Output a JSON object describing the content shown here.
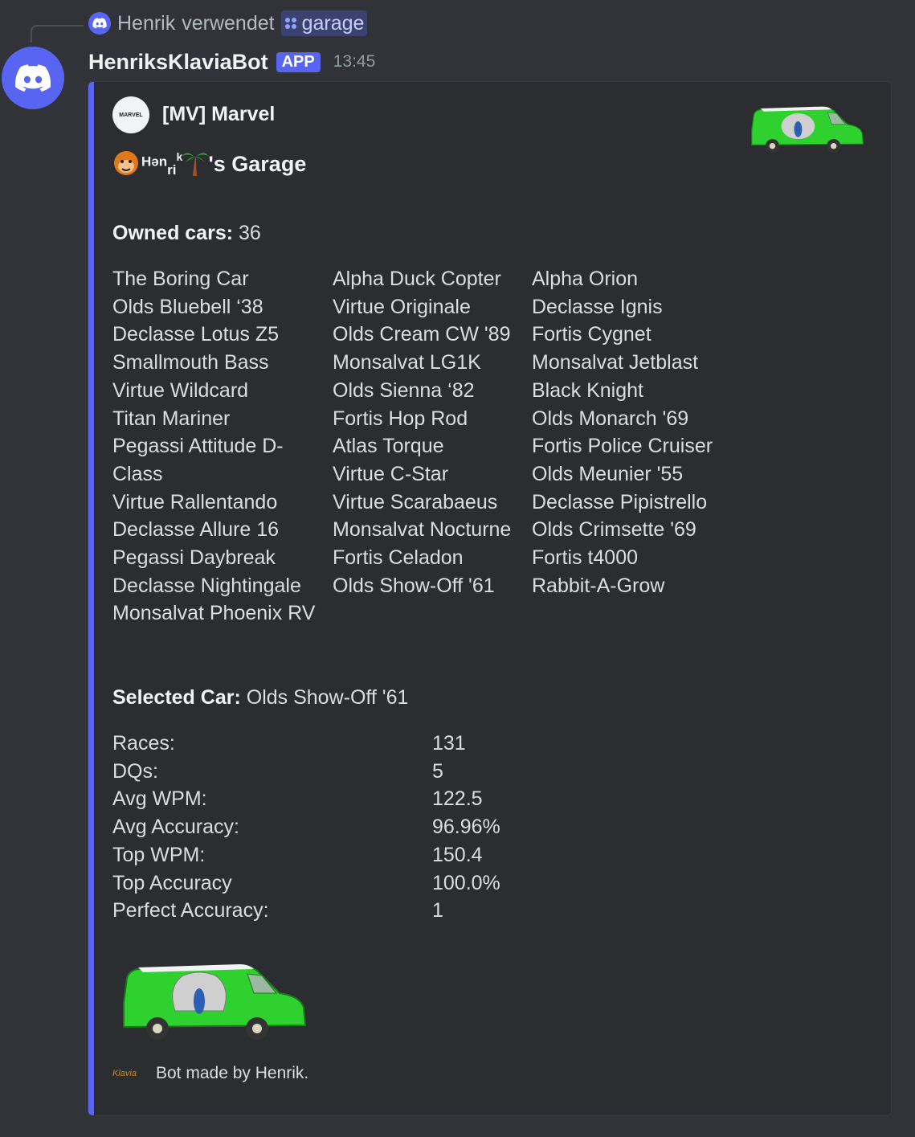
{
  "reply": {
    "user": "Henrik",
    "verb": "verwendet",
    "command": "garage",
    "accent": "#5865f2"
  },
  "message": {
    "bot_name": "HenriksKlaviaBot",
    "tag": "APP",
    "time": "13:45"
  },
  "embed": {
    "author_icon_text": "MARVEL",
    "author_name": "[MV] Marvel",
    "title_prefix": "Hən",
    "title_sub": "ri",
    "title_sup": "k",
    "title_suffix": "'s Garage",
    "owned_label": "Owned cars:",
    "owned_value": "36",
    "cars_col1": [
      "The Boring Car",
      "Olds Bluebell ‘38",
      "Declasse Lotus Z5",
      "Smallmouth Bass",
      "Virtue Wildcard",
      "Titan Mariner",
      "Pegassi Attitude D-Class",
      "Virtue Rallentando",
      "Declasse Allure 16",
      "Pegassi Daybreak",
      "Declasse Nightingale",
      "Monsalvat Phoenix RV"
    ],
    "cars_col2": [
      "Alpha Duck Copter",
      "Virtue Originale",
      "Olds Cream CW '89",
      "Monsalvat LG1K",
      "Olds Sienna ‘82",
      "Fortis Hop Rod",
      "Atlas Torque",
      "Virtue C-Star",
      "Virtue Scarabaeus",
      "Monsalvat Nocturne",
      "Fortis Celadon",
      "Olds Show-Off '61"
    ],
    "cars_col3": [
      "Alpha Orion",
      "Declasse Ignis",
      "Fortis Cygnet",
      "Monsalvat Jetblast",
      "Black Knight",
      "Olds Monarch '69",
      "Fortis Police Cruiser",
      "Olds Meunier '55",
      "Declasse Pipistrello",
      "Olds Crimsette '69",
      "Fortis t4000",
      "Rabbit-A-Grow"
    ],
    "selected_label": "Selected Car:",
    "selected_value": "Olds Show-Off '61",
    "stats": [
      {
        "label": "Races:",
        "value": "131"
      },
      {
        "label": "DQs:",
        "value": "5"
      },
      {
        "label": "Avg WPM:",
        "value": "122.5"
      },
      {
        "label": "Avg Accuracy:",
        "value": "96.96%"
      },
      {
        "label": "Top WPM:",
        "value": "150.4"
      },
      {
        "label": "Top Accuracy",
        "value": "100.0%"
      },
      {
        "label": "Perfect Accuracy:",
        "value": "1"
      }
    ],
    "footer_icon_text": "Klavia",
    "footer_text": "Bot made by Henrik.",
    "bar_color": "#5865f2",
    "van_color": "#2ed12e"
  }
}
